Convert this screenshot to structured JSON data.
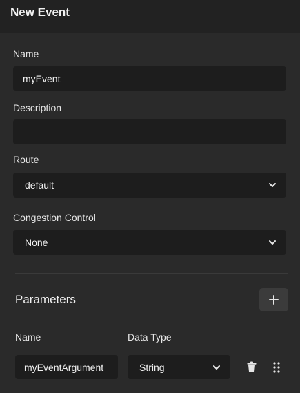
{
  "panel": {
    "title": "New Event"
  },
  "form": {
    "name_label": "Name",
    "name_value": "myEvent",
    "description_label": "Description",
    "description_value": "",
    "route_label": "Route",
    "route_value": "default",
    "congestion_label": "Congestion Control",
    "congestion_value": "None"
  },
  "parameters": {
    "title": "Parameters",
    "col_name_label": "Name",
    "col_type_label": "Data Type",
    "rows": [
      {
        "name": "myEventArgument",
        "type": "String"
      }
    ]
  },
  "icons": {
    "add": "plus-icon",
    "dropdown": "chevron-down-icon",
    "delete": "trash-icon",
    "drag": "drag-handle-icon"
  }
}
